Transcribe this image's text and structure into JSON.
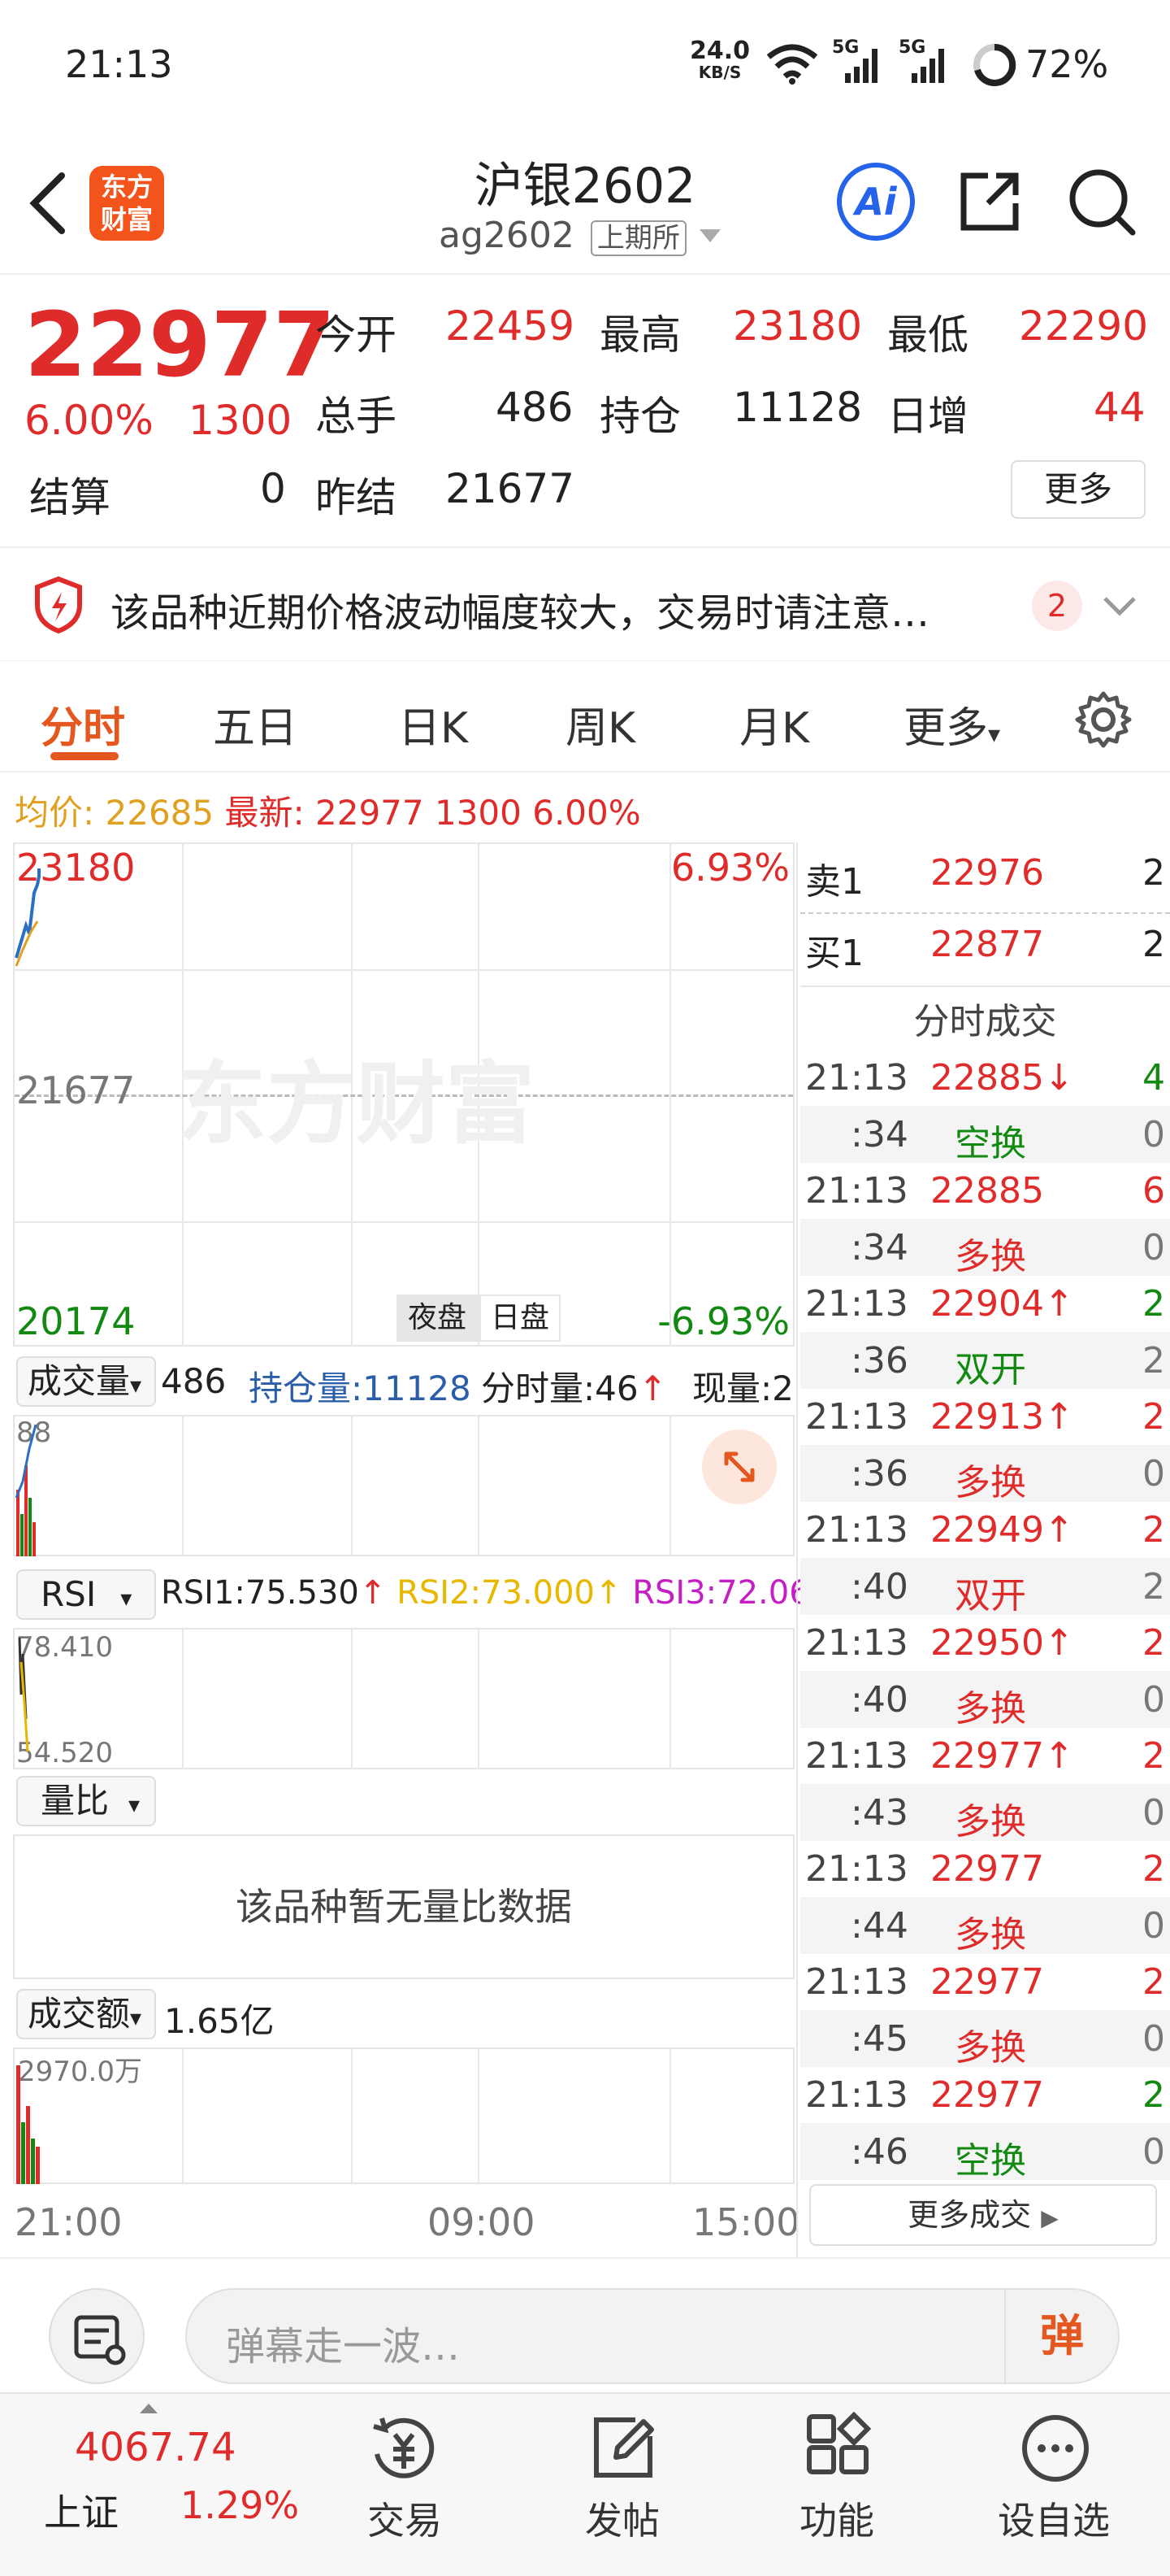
{
  "status": {
    "time": "21:13",
    "speed_value": "24.0",
    "speed_unit": "KB/S",
    "net1": "5G",
    "net2": "5G",
    "battery": "72%"
  },
  "header": {
    "title": "沪银2602",
    "code": "ag2602",
    "exchange": "上期所",
    "ai_label": "Ai"
  },
  "quote": {
    "price": "22977",
    "change_pct": "6.00%",
    "change": "1300",
    "open_label": "今开",
    "open": "22459",
    "high_label": "最高",
    "high": "23180",
    "low_label": "最低",
    "low": "22290",
    "vol_label": "总手",
    "vol": "486",
    "oi_label": "持仓",
    "oi": "11128",
    "inc_label": "日增",
    "inc": "44",
    "settle_label": "结算",
    "settle": "0",
    "prev_label": "昨结",
    "prev": "21677",
    "more": "更多"
  },
  "notice": {
    "text": "该品种近期价格波动幅度较大，交易时请注意…",
    "count": "2"
  },
  "tabs": [
    "分时",
    "五日",
    "日K",
    "周K",
    "月K",
    "更多"
  ],
  "summary": {
    "avg_label": "均价:",
    "avg": "22685",
    "latest_label": "最新:",
    "latest": "22977",
    "chg": "1300",
    "pct": "6.00%"
  },
  "chart": {
    "top": "23180",
    "mid": "21677",
    "bottom": "20174",
    "top_pct": "6.93%",
    "bottom_pct": "-6.93%",
    "night": "夜盘",
    "day": "日盘",
    "watermark": "东方财富",
    "xlabels": [
      "21:00",
      "09:00",
      "15:00"
    ]
  },
  "volume": {
    "label": "成交量",
    "value": "486",
    "oi": "持仓量:11128",
    "tick": "分时量:46",
    "now": "现量:2",
    "scale": "88"
  },
  "rsi": {
    "label": "RSI",
    "rsi1": "RSI1:75.530",
    "rsi2": "RSI2:73.000",
    "rsi3": "RSI3:72.060",
    "hi": "78.410",
    "lo": "54.520"
  },
  "ratio": {
    "label": "量比",
    "empty": "该品种暂无量比数据"
  },
  "amount": {
    "label": "成交额",
    "value": "1.65亿",
    "scale": "2970.0万"
  },
  "book": {
    "sell_label": "卖1",
    "sell_price": "22976",
    "sell_qty": "2",
    "buy_label": "买1",
    "buy_price": "22877",
    "buy_qty": "2"
  },
  "trades_title": "分时成交",
  "trades": [
    {
      "t": "21:13",
      "p": "22885↓",
      "q": "4",
      "pc": "red",
      "qc": "green"
    },
    {
      "t": ":34",
      "p": "空换",
      "q": "0",
      "pc": "green",
      "qc": "gray"
    },
    {
      "t": "21:13",
      "p": "22885",
      "q": "6",
      "pc": "red",
      "qc": "red"
    },
    {
      "t": ":34",
      "p": "多换",
      "q": "0",
      "pc": "red",
      "qc": "gray"
    },
    {
      "t": "21:13",
      "p": "22904↑",
      "q": "2",
      "pc": "red",
      "qc": "green"
    },
    {
      "t": ":36",
      "p": "双开",
      "q": "2",
      "pc": "green",
      "qc": "gray"
    },
    {
      "t": "21:13",
      "p": "22913↑",
      "q": "2",
      "pc": "red",
      "qc": "red"
    },
    {
      "t": ":36",
      "p": "多换",
      "q": "0",
      "pc": "red",
      "qc": "gray"
    },
    {
      "t": "21:13",
      "p": "22949↑",
      "q": "2",
      "pc": "red",
      "qc": "red"
    },
    {
      "t": ":40",
      "p": "双开",
      "q": "2",
      "pc": "red",
      "qc": "gray"
    },
    {
      "t": "21:13",
      "p": "22950↑",
      "q": "2",
      "pc": "red",
      "qc": "red"
    },
    {
      "t": ":40",
      "p": "多换",
      "q": "0",
      "pc": "red",
      "qc": "gray"
    },
    {
      "t": "21:13",
      "p": "22977↑",
      "q": "2",
      "pc": "red",
      "qc": "red"
    },
    {
      "t": ":43",
      "p": "多换",
      "q": "0",
      "pc": "red",
      "qc": "gray"
    },
    {
      "t": "21:13",
      "p": "22977",
      "q": "2",
      "pc": "red",
      "qc": "red"
    },
    {
      "t": ":44",
      "p": "多换",
      "q": "0",
      "pc": "red",
      "qc": "gray"
    },
    {
      "t": "21:13",
      "p": "22977",
      "q": "2",
      "pc": "red",
      "qc": "red"
    },
    {
      "t": ":45",
      "p": "多换",
      "q": "0",
      "pc": "red",
      "qc": "gray"
    },
    {
      "t": "21:13",
      "p": "22977",
      "q": "2",
      "pc": "red",
      "qc": "green"
    },
    {
      "t": ":46",
      "p": "空换",
      "q": "0",
      "pc": "green",
      "qc": "gray"
    }
  ],
  "more_trades": "更多成交",
  "danmu": {
    "placeholder": "弹幕走一波…",
    "send": "弹"
  },
  "nav": {
    "index_value": "4067.74",
    "index_name": "上证",
    "index_pct": "1.29%",
    "trade": "交易",
    "post": "发帖",
    "func": "功能",
    "watch": "设自选"
  }
}
